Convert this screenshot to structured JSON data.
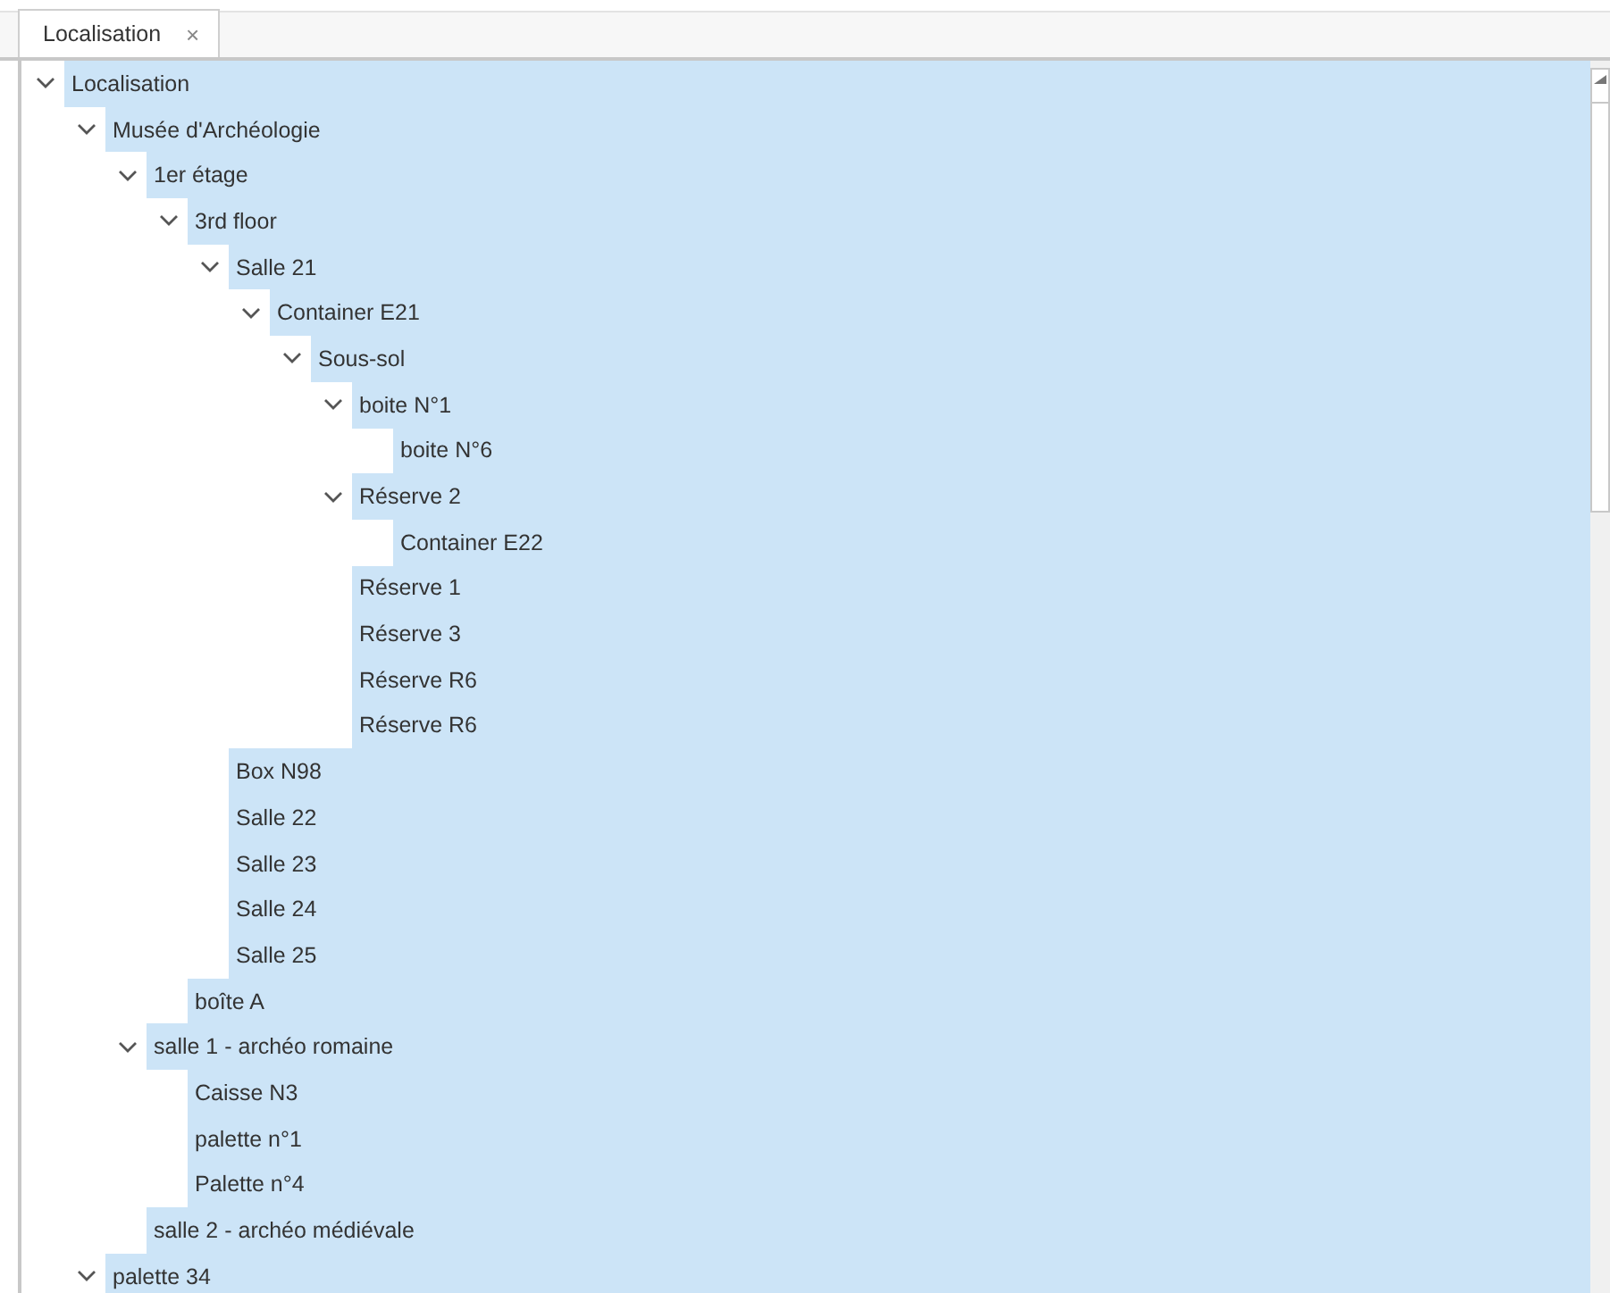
{
  "tabs": [
    {
      "label": "Localisation",
      "close": "×",
      "selected": true
    }
  ],
  "tree": [
    {
      "label": "Localisation",
      "selected": true,
      "expanded": true,
      "children": [
        {
          "label": "Musée d'Archéologie",
          "selected": true,
          "expanded": true,
          "children": [
            {
              "label": "1er étage",
              "selected": true,
              "expanded": true,
              "children": [
                {
                  "label": "3rd floor",
                  "selected": true,
                  "expanded": true,
                  "children": [
                    {
                      "label": "Salle 21",
                      "selected": true,
                      "expanded": true,
                      "children": [
                        {
                          "label": "Container E21",
                          "selected": true,
                          "expanded": true,
                          "children": [
                            {
                              "label": "Sous-sol",
                              "selected": true,
                              "expanded": true,
                              "children": [
                                {
                                  "label": "boite N°1",
                                  "selected": true,
                                  "expanded": true,
                                  "children": [
                                    {
                                      "label": "boite N°6",
                                      "selected": true
                                    }
                                  ]
                                },
                                {
                                  "label": "Réserve 2",
                                  "selected": true,
                                  "expanded": true,
                                  "children": [
                                    {
                                      "label": "Container E22",
                                      "selected": true
                                    }
                                  ]
                                },
                                {
                                  "label": "Réserve 1",
                                  "selected": true
                                },
                                {
                                  "label": "Réserve 3",
                                  "selected": true
                                },
                                {
                                  "label": "Réserve R6",
                                  "selected": true
                                },
                                {
                                  "label": "Réserve R6",
                                  "selected": true
                                }
                              ]
                            }
                          ]
                        }
                      ]
                    },
                    {
                      "label": "Box N98",
                      "selected": true
                    },
                    {
                      "label": "Salle 22",
                      "selected": true
                    },
                    {
                      "label": "Salle 23",
                      "selected": true
                    },
                    {
                      "label": "Salle 24",
                      "selected": true
                    },
                    {
                      "label": "Salle 25",
                      "selected": true
                    }
                  ]
                },
                {
                  "label": "boîte A",
                  "selected": true
                }
              ]
            },
            {
              "label": "salle 1 - archéo romaine",
              "selected": true,
              "expanded": true,
              "children": [
                {
                  "label": "Caisse N3",
                  "selected": true
                },
                {
                  "label": "palette n°1",
                  "selected": true
                },
                {
                  "label": "Palette n°4",
                  "selected": true
                }
              ]
            },
            {
              "label": "salle 2 - archéo médiévale",
              "selected": true
            }
          ]
        },
        {
          "label": "palette 34",
          "selected": true,
          "expanded": true
        }
      ]
    }
  ]
}
